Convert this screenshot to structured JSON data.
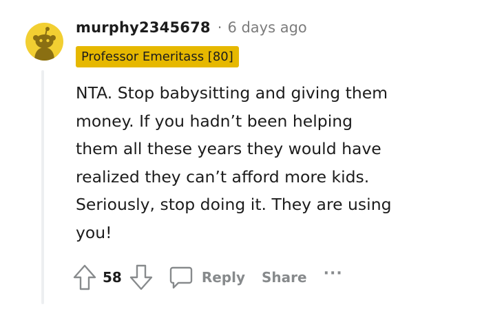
{
  "comment": {
    "username": "murphy2345678",
    "separator": "·",
    "timestamp": "6 days ago",
    "flair": "Professor Emeritass [80]",
    "body": "NTA. Stop babysitting and giving them money. If you hadn’t been helping them all these years they would have realized they can’t afford more kids. Seriously, stop doing it. They are using you!",
    "score": "58",
    "reply_label": "Reply",
    "share_label": "Share",
    "more_label": "···"
  },
  "colors": {
    "avatar_bg": "#f2cf32",
    "flair_bg": "#e6b800",
    "text": "#1c1c1c",
    "muted": "#878a8c"
  },
  "icons": {
    "avatar": "snoo-avatar-icon",
    "upvote": "upvote-arrow-icon",
    "downvote": "downvote-arrow-icon",
    "reply": "speech-bubble-icon"
  }
}
